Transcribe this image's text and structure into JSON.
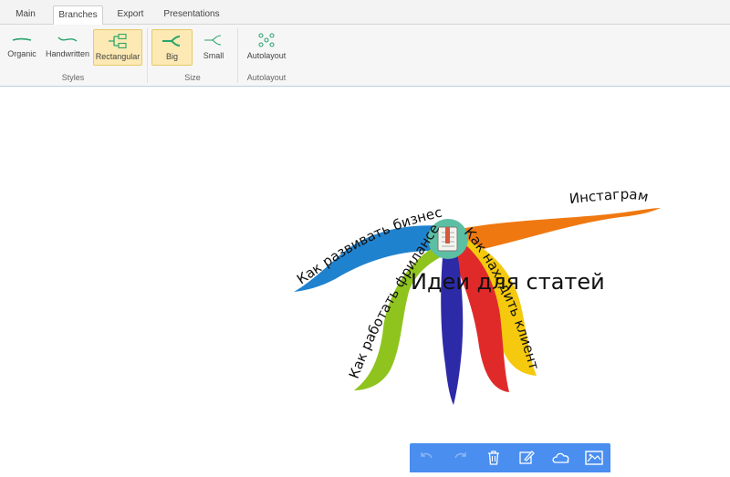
{
  "tabs": [
    {
      "label": "Main",
      "active": false
    },
    {
      "label": "Branches",
      "active": true
    },
    {
      "label": "Export",
      "active": false
    },
    {
      "label": "Presentations",
      "active": false
    }
  ],
  "ribbon": {
    "styles": {
      "group_label": "Styles",
      "buttons": [
        {
          "label": "Organic",
          "icon": "organic-branch-icon",
          "selected": false
        },
        {
          "label": "Handwritten",
          "icon": "handwritten-branch-icon",
          "selected": false
        },
        {
          "label": "Rectangular",
          "icon": "rectangular-branch-icon",
          "selected": true
        }
      ]
    },
    "size": {
      "group_label": "Size",
      "buttons": [
        {
          "label": "Big",
          "icon": "big-branch-icon",
          "selected": true
        },
        {
          "label": "Small",
          "icon": "small-branch-icon",
          "selected": false
        }
      ]
    },
    "autolayout": {
      "group_label": "Autolayout",
      "buttons": [
        {
          "label": "Autolayout",
          "icon": "autolayout-icon",
          "selected": false
        }
      ]
    }
  },
  "mindmap": {
    "central_topic": "Идеи для статей",
    "central_icon": "notebook-icon",
    "branches": [
      {
        "label": "Инстаграм",
        "color": "#f07810"
      },
      {
        "label": "Как развивать бизнес",
        "color": "#1f82cf"
      },
      {
        "label": "Как работать фрилансер",
        "color": "#8fc41e"
      },
      {
        "label": "Как находить клиентов",
        "color": "#f5c90d"
      },
      {
        "label": "",
        "color": "#e02a2a"
      },
      {
        "label": "",
        "color": "#2d2aa8"
      }
    ]
  },
  "bottom_toolbar": {
    "background": "#4a8ef0",
    "buttons": [
      {
        "icon": "undo-icon",
        "enabled": false
      },
      {
        "icon": "redo-icon",
        "enabled": false
      },
      {
        "icon": "trash-icon",
        "enabled": true
      },
      {
        "icon": "edit-icon",
        "enabled": true
      },
      {
        "icon": "cloud-icon",
        "enabled": true
      },
      {
        "icon": "image-icon",
        "enabled": true
      }
    ]
  },
  "colors": {
    "accent_selected": "#fce9b3",
    "icon_green": "#2aa56b",
    "central_circle": "#5cbfa3"
  }
}
